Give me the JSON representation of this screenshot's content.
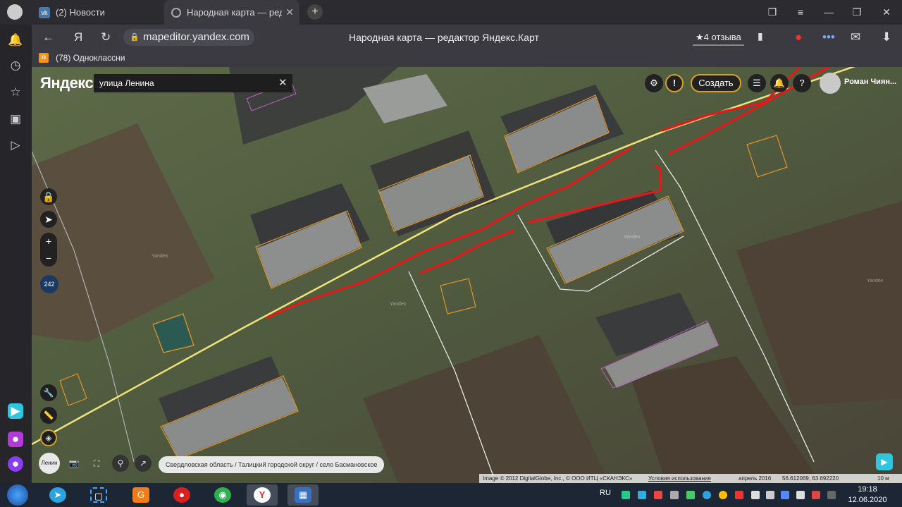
{
  "browser": {
    "tabs": [
      {
        "label": "(2) Новости",
        "active": false,
        "favicon": "vk-icon"
      },
      {
        "label": "Народная карта — редактор Яндекс.Карт",
        "short_label": "Народная карта — ред",
        "active": true,
        "favicon": "map-pin-icon"
      }
    ],
    "new_tab_label": "+",
    "address": {
      "back": "←",
      "yandex_letter": "Я",
      "url": "mapeditor.yandex.com"
    },
    "page_title": "Народная карта — редактор Яндекс.Карт",
    "reviews_label": "★4 отзыва",
    "bookmarks": [
      {
        "label": "(78) Одноклассни"
      }
    ]
  },
  "map_ui": {
    "logo": "Яндекс",
    "search_value": "улица Ленина",
    "create_button": "Создать",
    "alert_button": "!",
    "help_button": "?",
    "user_name": "Роман Чиян...",
    "zoom_badge": "242",
    "zoom_in": "+",
    "zoom_out": "−",
    "lenin_button": "Ленин",
    "breadcrumb": "Свердловская область / Талицкий городской округ / село Басмановское",
    "watermark": "Yandex",
    "copyright": {
      "image": "Image © 2012 DigitalGlobe, Inc., © ООО ИТЦ «СКАНЭКС»",
      "terms": "Условия использования",
      "date": "апрель 2016",
      "coords": "56.612069, 63.692220",
      "scale": "10 м"
    }
  },
  "taskbar": {
    "language": "RU",
    "time": "19:18",
    "date": "12.06.2020"
  },
  "colors": {
    "accent_create": "#d4a22a",
    "building_outline": "#e0952a",
    "red_annotation": "#e8181a",
    "road_yellow": "#f0e27a",
    "road_white": "#e8e8e8",
    "zoom_badge": "#1a3a64"
  }
}
